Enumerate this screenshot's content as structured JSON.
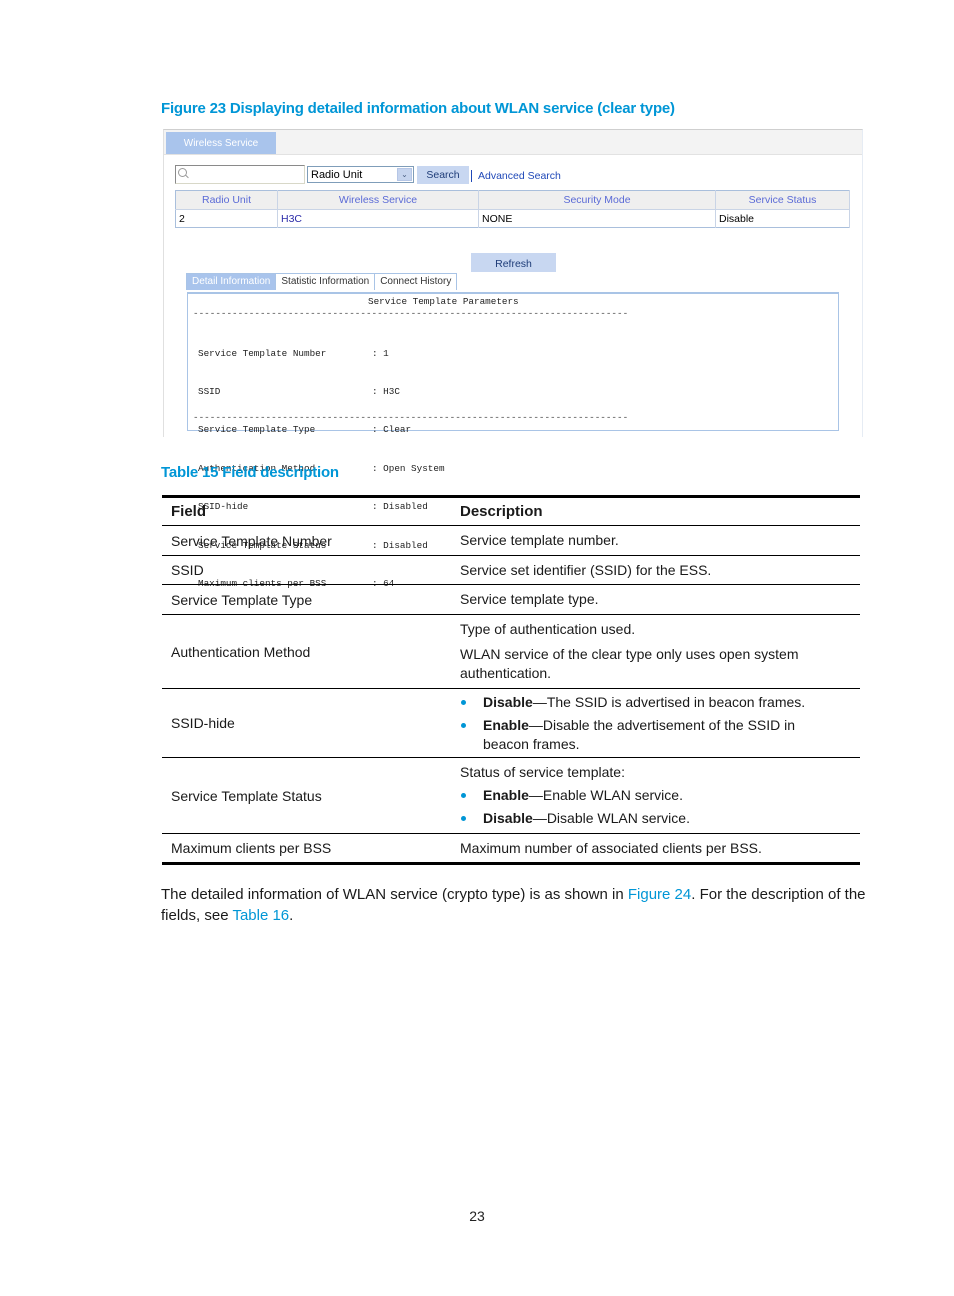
{
  "figure": {
    "caption": "Figure 23 Displaying detailed information about WLAN service (clear type)",
    "app": {
      "tab_label": "Wireless Service",
      "search": {
        "value": "",
        "placeholder": "",
        "field_select": "Radio Unit",
        "search_label": "Search",
        "advanced_label": "Advanced Search"
      },
      "grid": {
        "columns": [
          "Radio Unit",
          "Wireless Service",
          "Security Mode",
          "Service Status"
        ],
        "rows": [
          [
            "2",
            "H3C",
            "NONE",
            "Disable"
          ]
        ]
      },
      "refresh_label": "Refresh",
      "detail_tabs": [
        "Detail Information",
        "Statistic Information",
        "Connect History"
      ],
      "active_detail_tab": "Detail Information",
      "detail": {
        "title": "Service Template Parameters",
        "separator": "------------------------------------------------------------------------------",
        "params": [
          {
            "key": "Service Template Number",
            "value": ": 1"
          },
          {
            "key": "SSID",
            "value": ": H3C"
          },
          {
            "key": "Service Template Type",
            "value": ": Clear"
          },
          {
            "key": "Authentication Method",
            "value": ": Open System"
          },
          {
            "key": "SSID-hide",
            "value": ": Disabled"
          },
          {
            "key": "Service Template Status",
            "value": ": Disabled"
          },
          {
            "key": "Maximum clients per BSS",
            "value": ": 64"
          }
        ]
      }
    }
  },
  "table": {
    "caption": "Table 15 Field description",
    "headers": [
      "Field",
      "Description"
    ],
    "rows": [
      {
        "field": "Service Template Number",
        "desc": [
          "Service template number."
        ]
      },
      {
        "field": "SSID",
        "desc": [
          "Service set identifier (SSID) for the ESS."
        ]
      },
      {
        "field": "Service Template Type",
        "desc": [
          "Service template type."
        ]
      },
      {
        "field": "Authentication Method",
        "desc": [
          "Type of authentication used.",
          "WLAN service of the clear type only uses open system authentication."
        ]
      },
      {
        "field": "SSID-hide",
        "bullets": [
          {
            "term": "Disable",
            "text": "—The SSID is advertised in beacon frames."
          },
          {
            "term": "Enable",
            "text": "—Disable the advertisement of the SSID in beacon frames."
          }
        ]
      },
      {
        "field": "Service Template Status",
        "desc": [
          "Status of service template:"
        ],
        "bullets": [
          {
            "term": "Enable",
            "text": "—Enable WLAN service."
          },
          {
            "term": "Disable",
            "text": "—Disable WLAN service."
          }
        ]
      },
      {
        "field": "Maximum clients per BSS",
        "desc": [
          "Maximum number of associated clients per BSS."
        ]
      }
    ]
  },
  "paragraph": {
    "t1": "The detailed information of WLAN service (crypto type) is as shown in ",
    "link1": "Figure 24",
    "t2": ". For the description of the fields, see ",
    "link2": "Table 16",
    "t3": "."
  },
  "page_number": "23",
  "colors": {
    "accent": "#0096d6",
    "tab_blue": "#a9c4ec",
    "header_text": "#5a6ad6"
  }
}
